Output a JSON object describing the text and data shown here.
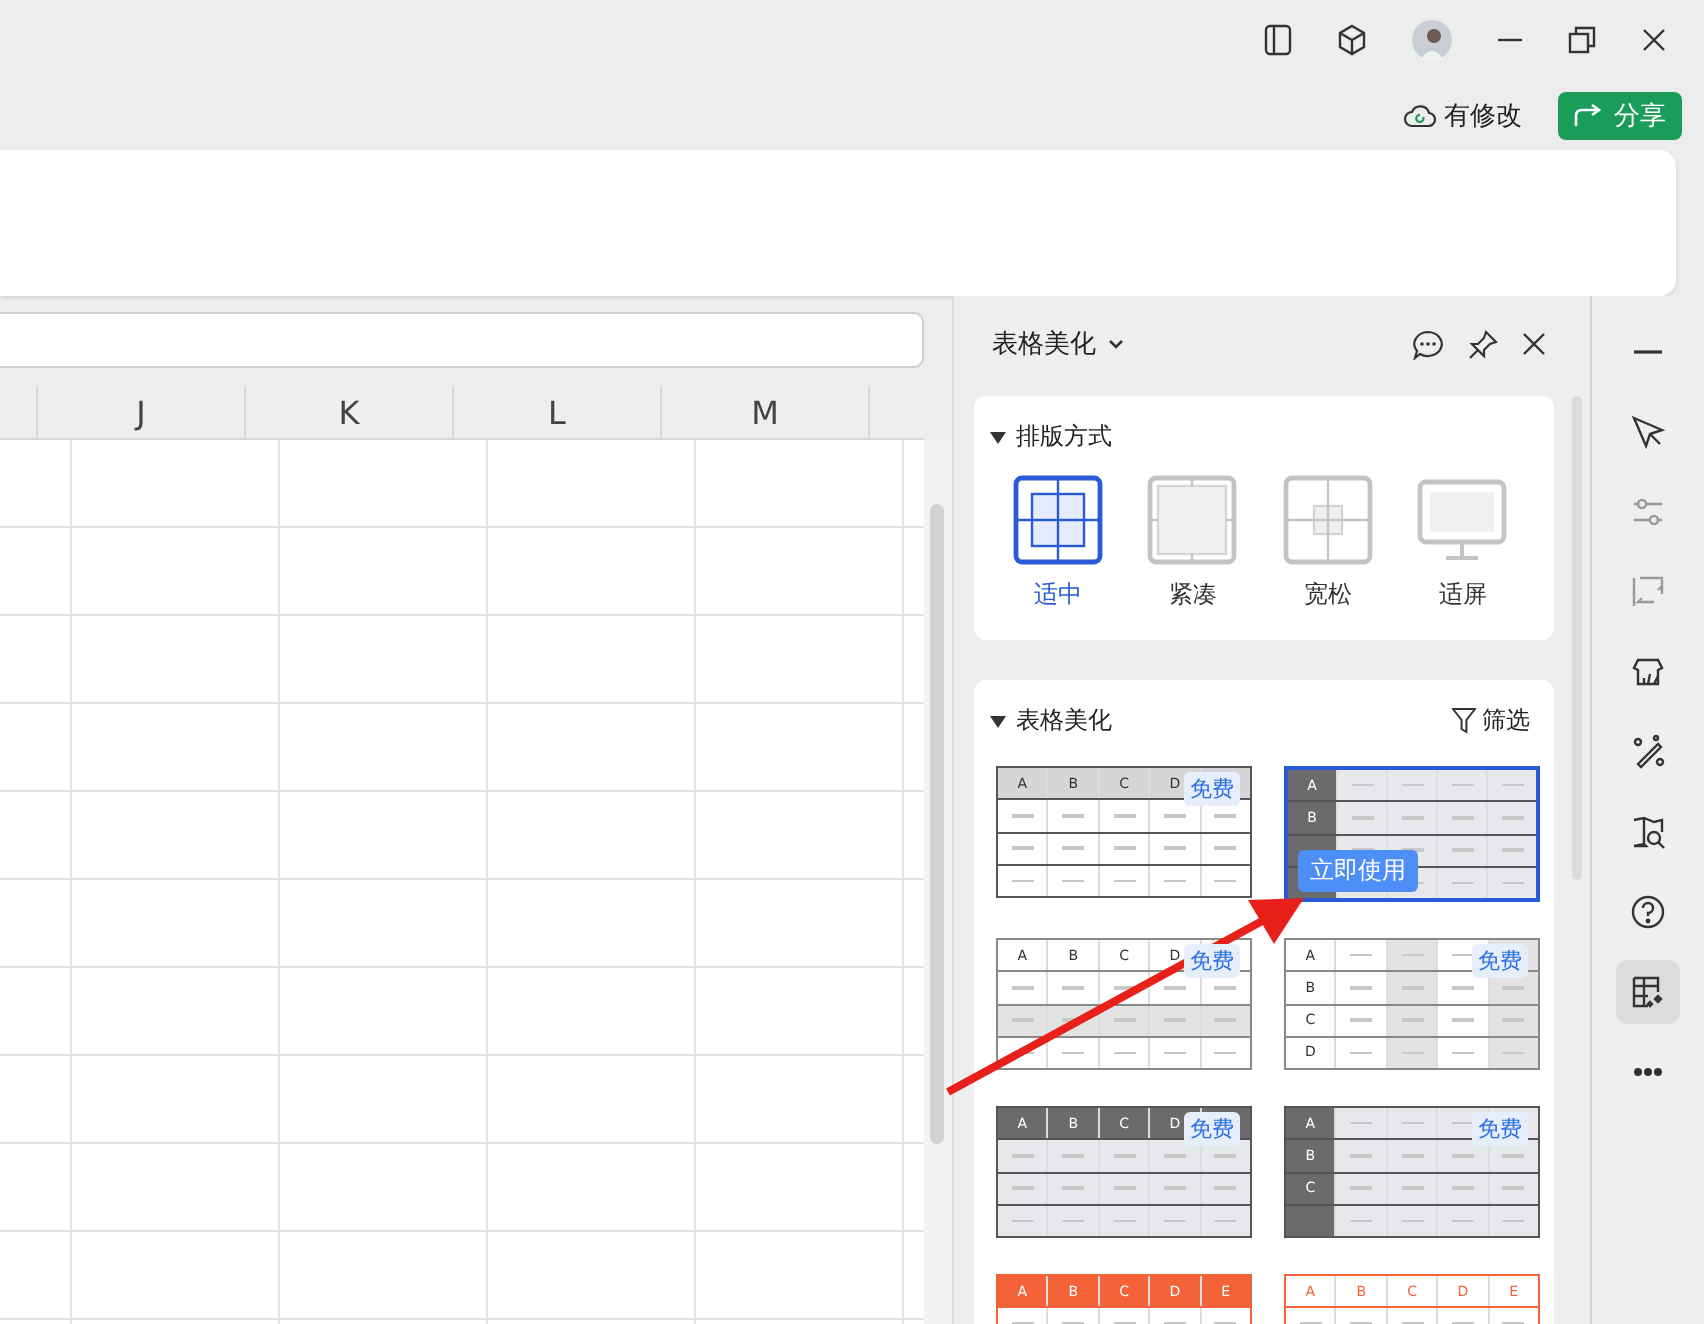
{
  "status": {
    "save_state": "有修改",
    "share_button": "分享"
  },
  "sheet": {
    "columns": [
      "J",
      "K",
      "L",
      "M"
    ]
  },
  "panel": {
    "title": "表格美化",
    "layout_section": {
      "title": "排版方式",
      "options": [
        {
          "label": "适中",
          "selected": true
        },
        {
          "label": "紧凑",
          "selected": false
        },
        {
          "label": "宽松",
          "selected": false
        },
        {
          "label": "适屏",
          "selected": false
        }
      ]
    },
    "style_section": {
      "title": "表格美化",
      "filter": "筛选",
      "templates": [
        {
          "letters": [
            "A",
            "B",
            "C",
            "D"
          ],
          "badge": "免费",
          "selected": false
        },
        {
          "letters": [
            "A",
            "B"
          ],
          "action": "立即使用",
          "selected": true
        },
        {
          "letters": [
            "A",
            "B",
            "C",
            "D"
          ],
          "badge": "免费",
          "selected": false
        },
        {
          "letters": [
            "A",
            "B",
            "C",
            "D"
          ],
          "badge": "免费",
          "selected": false
        },
        {
          "letters": [
            "A",
            "B",
            "C",
            "D"
          ],
          "badge": "免费",
          "selected": false
        },
        {
          "letters": [
            "A",
            "B",
            "C"
          ],
          "badge": "免费",
          "selected": false
        },
        {
          "letters": [
            "A",
            "B",
            "C",
            "D",
            "E"
          ],
          "selected": false
        },
        {
          "letters": [
            "A",
            "B",
            "C",
            "D",
            "E"
          ],
          "selected": false
        }
      ]
    }
  },
  "right_toolbar": [
    {
      "selected": false
    },
    {
      "selected": false
    },
    {
      "selected": false
    },
    {
      "selected": false
    },
    {
      "selected": false
    },
    {
      "selected": false
    },
    {
      "selected": false
    },
    {
      "selected": false
    },
    {
      "selected": true
    },
    {
      "selected": false
    }
  ],
  "annotations": [
    {
      "kind": "arrow"
    }
  ]
}
